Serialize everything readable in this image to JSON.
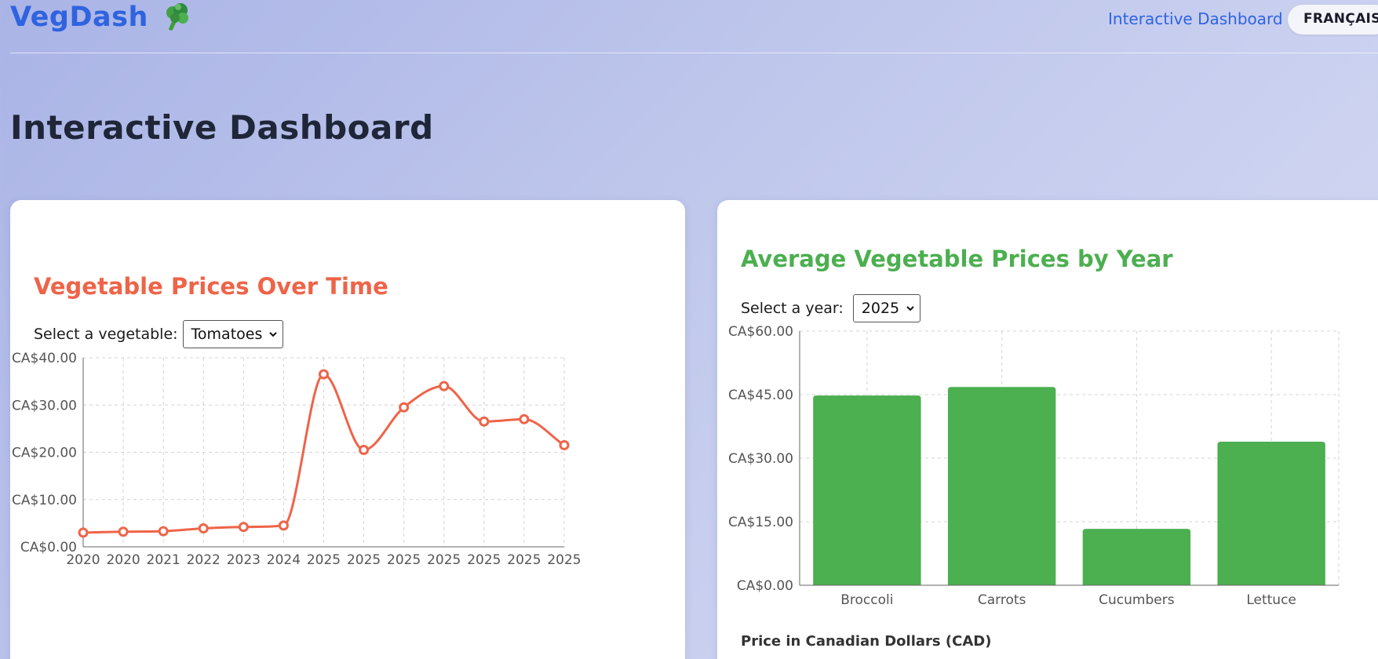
{
  "header": {
    "logo_text": "VegDash",
    "logo_icon": "broccoli-icon",
    "nav_link": "Interactive Dashboard",
    "lang_button": "FRANÇAIS"
  },
  "page": {
    "title": "Interactive Dashboard"
  },
  "line_card": {
    "title": "Vegetable Prices Over Time",
    "select_label": "Select a vegetable:",
    "select_value": "Tomatoes"
  },
  "bar_card": {
    "title": "Average Vegetable Prices by Year",
    "select_label": "Select a year:",
    "select_value": "2025",
    "footnote": "Price in Canadian Dollars (CAD)"
  },
  "colors": {
    "line": "#ee6448",
    "bar": "#4caf50",
    "brand": "#2f63e0"
  },
  "chart_data": [
    {
      "type": "line",
      "title": "Vegetable Prices Over Time",
      "x": [
        "2020",
        "2020",
        "2021",
        "2022",
        "2023",
        "2024",
        "2025",
        "2025",
        "2025",
        "2025",
        "2025",
        "2025",
        "2025"
      ],
      "series": [
        {
          "values": [
            3.0,
            3.2,
            3.3,
            3.9,
            4.2,
            4.5,
            36.5,
            20.5,
            29.5,
            34.0,
            26.5,
            27.0,
            21.5
          ]
        }
      ],
      "y_ticks": [
        "CA$0.00",
        "CA$10.00",
        "CA$20.00",
        "CA$30.00",
        "CA$40.00"
      ],
      "ylim": [
        0,
        40
      ],
      "grid": true
    },
    {
      "type": "bar",
      "title": "Average Vegetable Prices by Year",
      "categories": [
        "Broccoli",
        "Carrots",
        "Cucumbers",
        "Lettuce"
      ],
      "values": [
        44.8,
        46.8,
        13.3,
        33.9
      ],
      "y_ticks": [
        "CA$0.00",
        "CA$15.00",
        "CA$30.00",
        "CA$45.00",
        "CA$60.00"
      ],
      "ylim": [
        0,
        60
      ],
      "ylabel": "Price in Canadian Dollars (CAD)",
      "grid": true
    }
  ]
}
